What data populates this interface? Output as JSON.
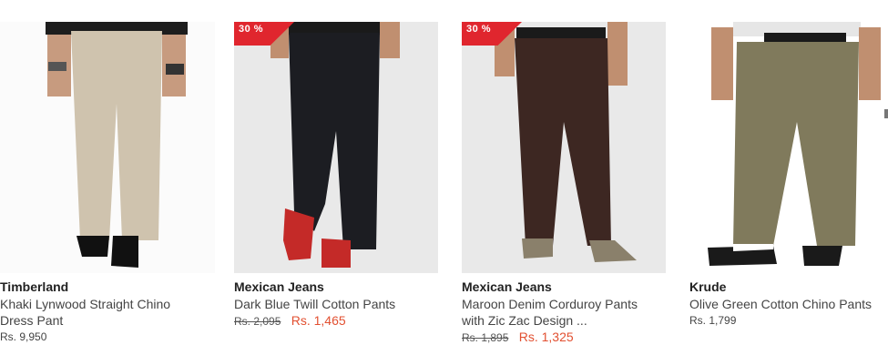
{
  "products": [
    {
      "brand": "Timberland",
      "title_line1": "Khaki Lynwood Straight Chino",
      "title_line2": "Dress Pant",
      "price": "Rs. 9,950"
    },
    {
      "brand": "Mexican Jeans",
      "title_line1": "Dark Blue Twill Cotton Pants",
      "badge": "30 %",
      "old_price": "Rs. 2,095",
      "new_price": "Rs. 1,465"
    },
    {
      "brand": "Mexican Jeans",
      "title_line1": "Maroon Denim Corduroy Pants",
      "title_line2": "with Zic Zac Design ...",
      "badge": "30 %",
      "old_price": "Rs. 1,895",
      "new_price": "Rs. 1,325"
    },
    {
      "brand": "Krude",
      "title_line1": "Olive Green Cotton Chino Pants",
      "price": "Rs. 1,799"
    }
  ],
  "colors": {
    "sale_badge": "#e0262e",
    "sale_price": "#e25031",
    "khaki": "#cfc3ae",
    "navy": "#1c1d22",
    "maroon": "#3d2722",
    "olive": "#807a5c"
  }
}
